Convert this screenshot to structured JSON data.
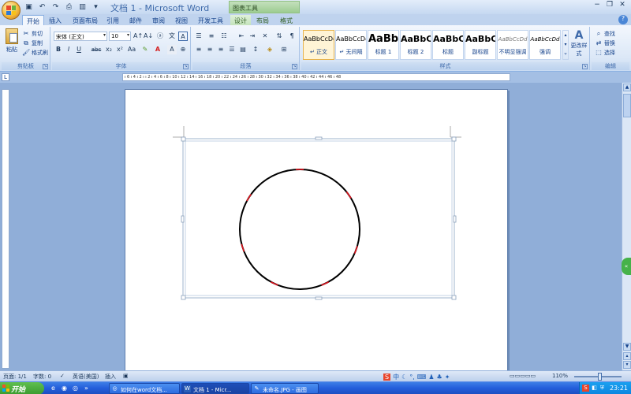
{
  "window": {
    "title": "文档 1 - Microsoft Word",
    "context_tool_title": "图表工具",
    "controls": [
      "−",
      "❐",
      "✕"
    ]
  },
  "tabs": [
    {
      "label": "开始",
      "active": true
    },
    {
      "label": "插入"
    },
    {
      "label": "页面布局"
    },
    {
      "label": "引用"
    },
    {
      "label": "邮件"
    },
    {
      "label": "审阅"
    },
    {
      "label": "视图"
    },
    {
      "label": "开发工具"
    },
    {
      "label": "设计",
      "context": true
    },
    {
      "label": "布局",
      "context": true
    },
    {
      "label": "格式",
      "context": true
    }
  ],
  "clipboard": {
    "paste_label": "粘贴",
    "cut_label": "剪切",
    "copy_label": "复制",
    "format_painter_label": "格式刷",
    "group_label": "剪贴板"
  },
  "font": {
    "family_value": "宋体 (正文)",
    "size_value": "10",
    "group_label": "字体",
    "bold": "B",
    "italic": "I",
    "underline": "U",
    "strike": "abc",
    "subscript": "x₂",
    "superscript": "x²",
    "case": "Aa",
    "clear": "A",
    "grow": "A↑",
    "shrink": "A↓"
  },
  "paragraph": {
    "group_label": "段落"
  },
  "styles": {
    "group_label": "样式",
    "items": [
      {
        "sample": "AaBbCcDd",
        "name": "↵ 正文",
        "selected": true
      },
      {
        "sample": "AaBbCcDd",
        "name": "↵ 无间隔"
      },
      {
        "sample": "AaBb",
        "name": "标题 1"
      },
      {
        "sample": "AaBbC",
        "name": "标题 2"
      },
      {
        "sample": "AaBbC",
        "name": "标题"
      },
      {
        "sample": "AaBbC",
        "name": "副标题"
      },
      {
        "sample": "AaBbCcDd",
        "name": "不明显强调"
      },
      {
        "sample": "AaBbCcDd",
        "name": "强调"
      }
    ],
    "change_styles_label": "更改样式"
  },
  "editing": {
    "group_label": "编辑",
    "find_label": "查找",
    "replace_label": "替换",
    "select_label": "选择"
  },
  "ruler": {
    "marks": "ı 6 ı 4 ı 2 ı    ı 2 ı 4 ı 6 ı 8 ı 10 ı 12 ı 14 ı 16 ı 18 ı 20 ı 22 ı 24 ı 26 ı 28 ı 30 ı 32 ı 34 ı 36 ı 38 ı 40 ı 42 ı 44 ı 46 ı 48",
    "corner": "L"
  },
  "status": {
    "page": "页面: 1/1",
    "words": "字数: 0",
    "language": "英语(美国)",
    "mode": "插入",
    "zoom": "110%"
  },
  "taskbar": {
    "start_label": "开始",
    "tasks": [
      {
        "label": "如何在word文档..."
      },
      {
        "label": "文档 1 - Micr...",
        "active": true
      },
      {
        "label": "未命名.JPG - 画图"
      }
    ],
    "clock": "23:21"
  },
  "colors": {
    "tick": "#e0141e",
    "circle": "#000000"
  }
}
